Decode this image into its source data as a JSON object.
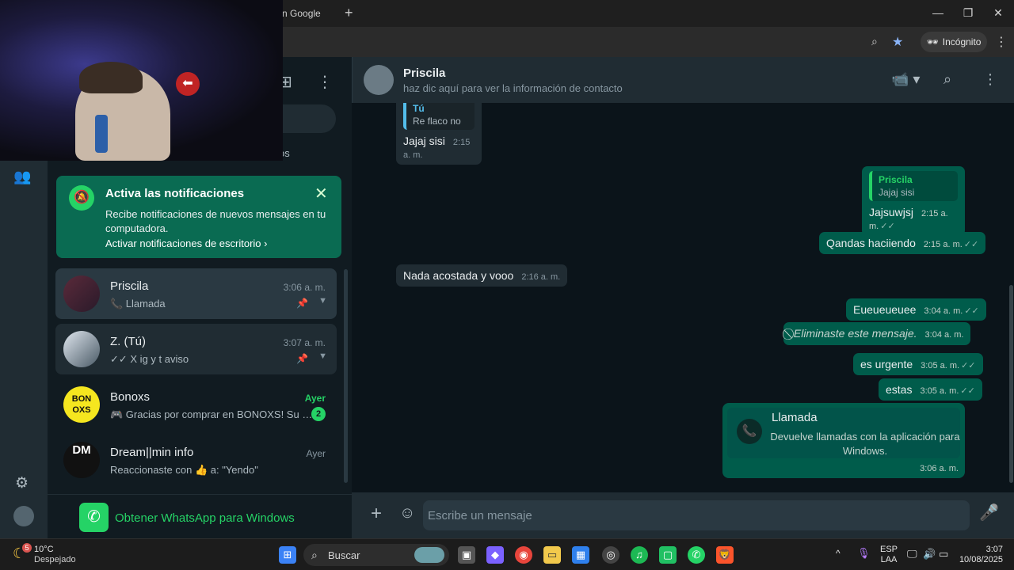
{
  "browser": {
    "tab_title": "n Google",
    "tab_close": "✕",
    "new_tab": "+",
    "window_controls": [
      "—",
      "❐",
      "✕"
    ],
    "incognito_label": "Incógnito",
    "toolbar_icons": [
      "zoom-icon",
      "star-icon",
      "more-vert-icon"
    ]
  },
  "sidebar": {
    "icons": [
      "new-chat-icon",
      "menu-icon",
      "communities-icon",
      "settings-icon",
      "profile-icon"
    ],
    "partial_filter_text": "os"
  },
  "notification": {
    "title": "Activa las notificaciones",
    "body": "Recibe notificaciones de nuevos mensajes en tu computadora.",
    "link": "Activar notificaciones de escritorio ›",
    "close": "✕",
    "bell": "🔕"
  },
  "chats": [
    {
      "name": "Priscila",
      "time": "3:06 a. m.",
      "preview": "📞 Llamada",
      "pinned": true
    },
    {
      "name": "Z. (Tú)",
      "time": "3:07 a. m.",
      "preview": "✓✓ X ig y t aviso",
      "pinned": true
    },
    {
      "name": "Bonoxs",
      "time": "Ayer",
      "preview": "🎮 Gracias por comprar en BONOXS! Su p...",
      "badge": "2",
      "avatar_text": "BON OXS"
    },
    {
      "name": "Dream||min info",
      "time": "Ayer",
      "preview": "Reaccionaste con 👍 a: \"Yendo\"",
      "avatar_text": "DM"
    }
  ],
  "get_whatsapp": "Obtener WhatsApp para Windows",
  "chat_header": {
    "name": "Priscila",
    "subtitle": "haz dic aquí para ver la información de contacto"
  },
  "messages": {
    "m1_quote_name": "Tú",
    "m1_quote_text": "Re flaco no",
    "m1_text": "Jajaj sisi",
    "m1_time": "2:15 a. m.",
    "m2_quote_name": "Priscila",
    "m2_quote_text": "Jajaj sisi",
    "m2_text": "Jajsuwjsj",
    "m2_time": "2:15 a. m.",
    "m3_text": "Qandas haciiendo",
    "m3_time": "2:15 a. m.",
    "m4_text": "Nada acostada y vooo",
    "m4_time": "2:16 a. m.",
    "m5_text": "Eueueueuee",
    "m5_time": "3:04 a. m.",
    "m6_text": "Eliminaste este mensaje.",
    "m6_time": "3:04 a. m.",
    "m7_text": "es urgente",
    "m7_time": "3:05 a. m.",
    "m8_text": "estas",
    "m8_time": "3:05 a. m.",
    "call_title": "Llamada",
    "call_desc": "Devuelve llamadas con la aplicación para Windows.",
    "call_time": "3:06 a. m.",
    "ticks": "✓✓"
  },
  "compose": {
    "placeholder": "Escribe un mensaje"
  },
  "taskbar": {
    "weather_temp": "10°C",
    "weather_desc": "Despejado",
    "weather_badge": "5",
    "search_label": "Buscar",
    "lang_1": "ESP",
    "lang_2": "LAA",
    "time": "3:07",
    "date": "10/08/2025"
  },
  "colors": {
    "accent": "#25d366",
    "outgoing_bubble": "#005c4b",
    "incoming_bubble": "#202c33",
    "notification_bg": "#0a6b52"
  }
}
